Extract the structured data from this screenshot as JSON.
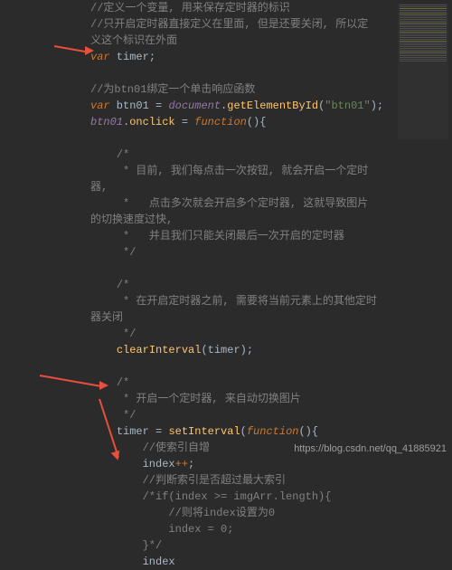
{
  "code": {
    "c1": "//定义一个变量, 用来保存定时器的标识",
    "c2": "//只开启定时器直接定义在里面, 但是还要关闭, 所以定",
    "c3": "义这个标识在外面",
    "l_var": "var",
    "l_timer": " timer",
    "semi": ";",
    "c4": "//为btn01绑定一个单击响应函数",
    "btn01": " btn01 ",
    "eq": "= ",
    "document": "document",
    "dot": ".",
    "getElementById": "getElementById",
    "lp": "(",
    "rp": ")",
    "s_btn01": "\"btn01\"",
    "btn01ref": "btn01",
    "onclick": "onclick",
    "function": "function",
    "empty": "()",
    "lb": "{",
    "rb": "}",
    "c5": "/*",
    "c6": " * 目前, 我们每点击一次按钮, 就会开启一个定时",
    "c7": "器,",
    "c8": " *   点击多次就会开启多个定时器, 这就导致图片",
    "c9": "的切换速度过快,",
    "c10": " *   并且我们只能关闭最后一次开启的定时器",
    "c11": " */",
    "c12": "/*",
    "c13": " * 在开启定时器之前, 需要将当前元素上的其他定时",
    "c14": "器关闭",
    "c15": " */",
    "clearInterval": "clearInterval",
    "timerArg": "timer",
    "c16": "/*",
    "c17": " * 开启一个定时器, 来自动切换图片",
    "c18": " */",
    "timerAssign": "timer ",
    "setInterval": "setInterval",
    "c19": "//使索引自增",
    "index": "index",
    "pp": "++",
    "c20": "//判断索引是否超过最大索引",
    "c21": "/*if(index >= imgArr.length){",
    "c22": "    //则将index设置为0",
    "c23": "    index = 0;",
    "c24": "}*/",
    "indexMod": "index "
  },
  "watermark": "https://blog.csdn.net/qq_41885921"
}
